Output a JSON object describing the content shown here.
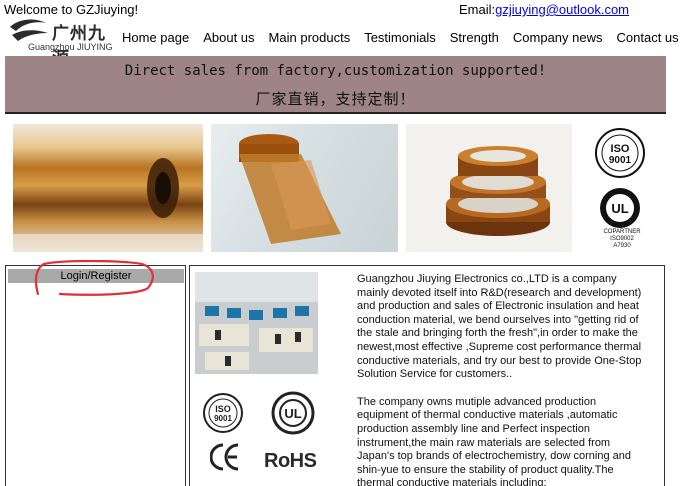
{
  "header": {
    "welcome": "Welcome to GZJiuying!",
    "email_label": "Email:",
    "email_address": "gzjiuying@outlook.com"
  },
  "logo": {
    "cn_name": "广州九源",
    "en_name": "Guangzhou JIUYING"
  },
  "nav": {
    "items": [
      "Home page",
      "About us",
      "Main products",
      "Testimonials",
      "Strength",
      "Company news",
      "Contact us"
    ]
  },
  "banner": {
    "line_en": "Direct sales from factory,customization supported!",
    "line_cn": "厂家直销，支持定制！"
  },
  "certifications": {
    "iso_label": "ISO",
    "iso_number": "9001",
    "ul_label": "UL",
    "caption_lines": [
      "COPARTNER",
      "ISO9002",
      "A7930"
    ],
    "ce_label": "CE",
    "rohs_label": "RoHS"
  },
  "sidebar": {
    "login_label": "Login/Register"
  },
  "about": {
    "paragraph1": "Guangzhou Jiuying Electronics co.,LTD is a company mainly devoted itself into R&D(research and development) and production and sales of Electronic insulation and heat conduction material, we bend ourselves into \"getting rid of the stale and bringing forth the fresh\",in order to make the newest,most effective ,Supreme cost performance thermal conductive materials, and try our best to provide One-Stop Solution Service for customers..",
    "paragraph2": "The company owns mutiple advanced production equipment of thermal conductive materials ,automatic production assembly line and Perfect inspection instrument,the main raw materials are selected from Japan's top brands of electrochemistry, dow corning and shin-yue to ensure the stability of product quality.The thermal conductive materials including:"
  },
  "colors": {
    "banner_bg": "#9e8484",
    "link": "#0000ee",
    "login_bar": "#a9a9a9",
    "annotation_red": "#e0303a"
  }
}
